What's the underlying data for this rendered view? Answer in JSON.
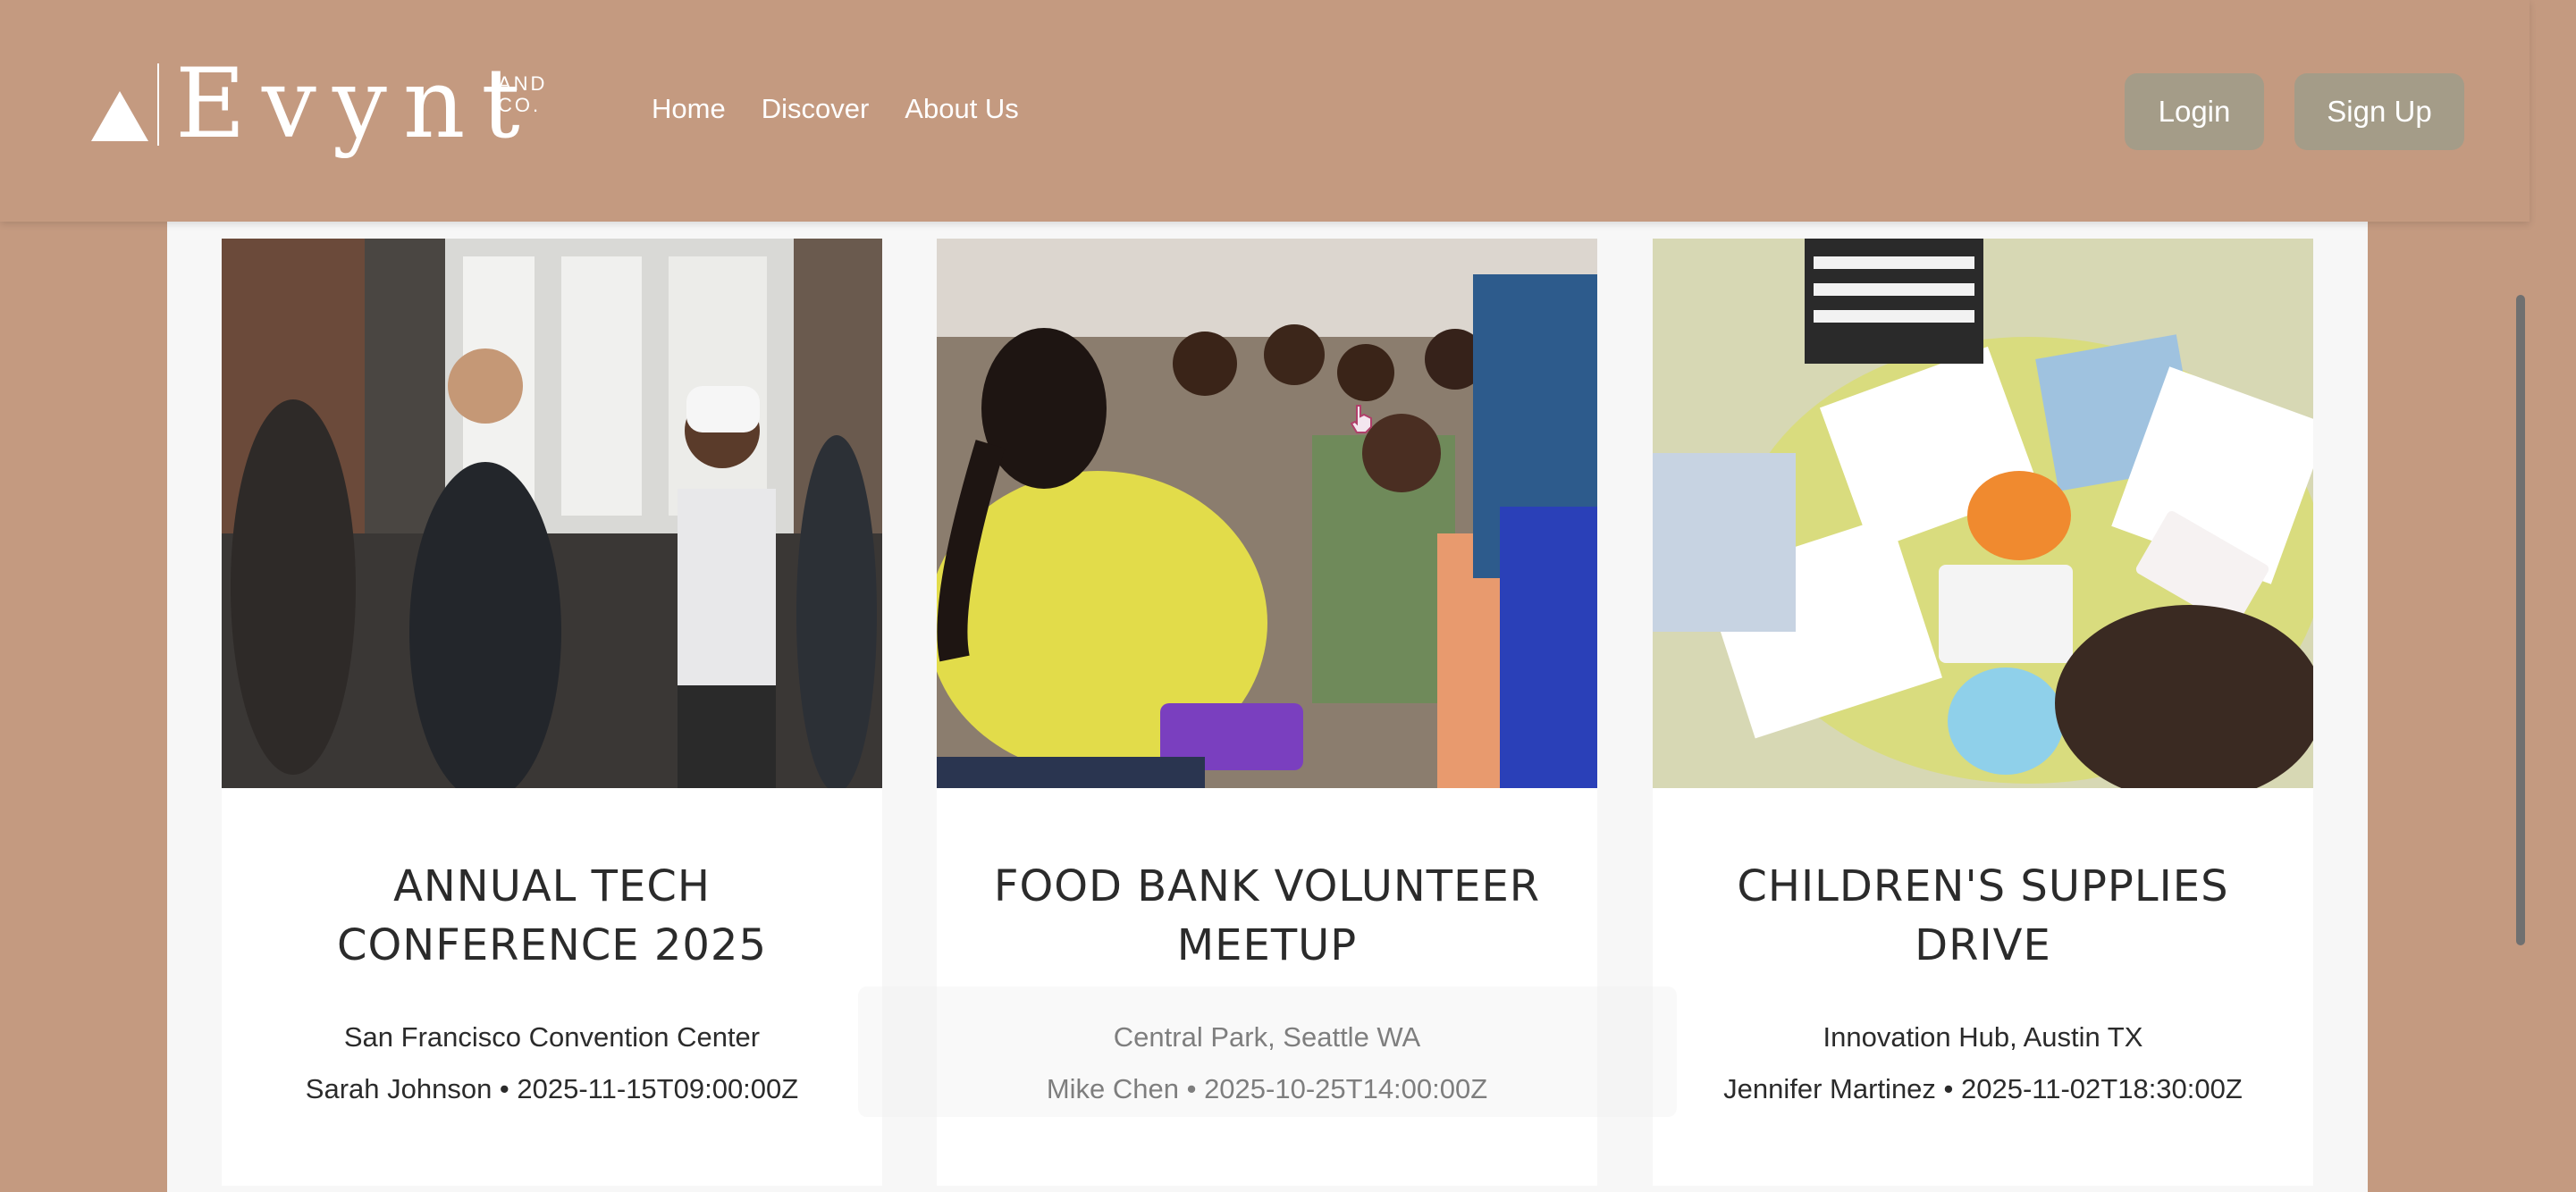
{
  "header": {
    "logo": {
      "word": "Evynt",
      "sub_line1": "AND",
      "sub_line2": "CO."
    },
    "nav": [
      "Home",
      "Discover",
      "About Us"
    ],
    "login_label": "Login",
    "signup_label": "Sign Up"
  },
  "colors": {
    "background": "#c49a80",
    "button": "#a49c88",
    "content": "#f7f7f7",
    "card": "#ffffff",
    "text": "#2b2b2b"
  },
  "events": [
    {
      "title": "ANNUAL TECH CONFERENCE 2025",
      "venue": "San Francisco Convention Center",
      "meta": "Sarah Johnson • 2025-11-15T09:00:00Z",
      "image_icon": "photo-vr-conference"
    },
    {
      "title": "FOOD BANK VOLUNTEER MEETUP",
      "venue": "Central Park, Seattle WA",
      "meta": "Mike Chen • 2025-10-25T14:00:00Z",
      "image_icon": "photo-volunteer-children"
    },
    {
      "title": "CHILDREN'S SUPPLIES DRIVE",
      "venue": "Innovation Hub, Austin TX",
      "meta": "Jennifer Martinez • 2025-11-02T18:30:00Z",
      "image_icon": "photo-kids-painting"
    }
  ]
}
